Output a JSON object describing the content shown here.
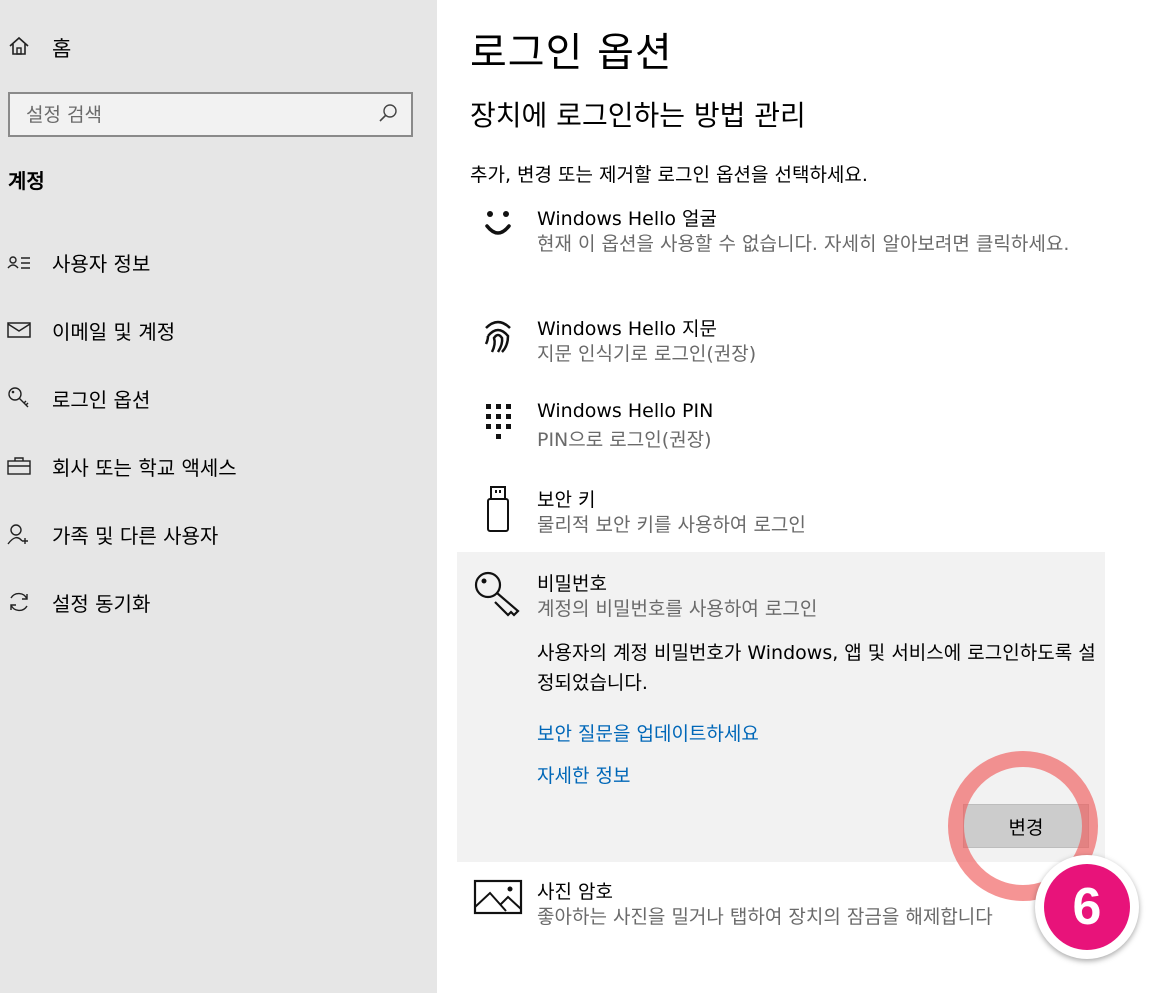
{
  "sidebar": {
    "home_label": "홈",
    "search_placeholder": "설정 검색",
    "section_title": "계정",
    "items": [
      {
        "label": "사용자 정보",
        "icon": "user-info-icon"
      },
      {
        "label": "이메일 및 계정",
        "icon": "mail-icon"
      },
      {
        "label": "로그인 옵션",
        "icon": "key-icon"
      },
      {
        "label": "회사 또는 학교 액세스",
        "icon": "briefcase-icon"
      },
      {
        "label": "가족 및 다른 사용자",
        "icon": "add-user-icon"
      },
      {
        "label": "설정 동기화",
        "icon": "sync-icon"
      }
    ]
  },
  "main": {
    "title": "로그인 옵션",
    "subtitle": "장치에 로그인하는 방법 관리",
    "description": "추가, 변경 또는 제거할 로그인 옵션을 선택하세요.",
    "options": [
      {
        "title": "Windows Hello 얼굴",
        "subtitle": "현재 이 옵션을 사용할 수 없습니다. 자세히 알아보려면 클릭하세요.",
        "icon": "face-icon"
      },
      {
        "title": "Windows Hello 지문",
        "subtitle": "지문 인식기로 로그인(권장)",
        "icon": "fingerprint-icon"
      },
      {
        "title": "Windows Hello PIN",
        "subtitle": "PIN으로 로그인(권장)",
        "icon": "pin-keypad-icon"
      },
      {
        "title": "보안 키",
        "subtitle": "물리적 보안 키를 사용하여 로그인",
        "icon": "usb-key-icon"
      },
      {
        "title": "비밀번호",
        "subtitle": "계정의 비밀번호를 사용하여 로그인",
        "icon": "password-key-icon"
      },
      {
        "title": "사진 암호",
        "subtitle": "좋아하는 사진을 밀거나 탭하여 장치의 잠금을 해제합니다",
        "icon": "picture-icon"
      }
    ],
    "password_panel": {
      "info": "사용자의 계정 비밀번호가 Windows, 앱 및 서비스에 로그인하도록 설정되었습니다.",
      "link_security_questions": "보안 질문을 업데이트하세요",
      "link_more_info": "자세한 정보",
      "change_button": "변경"
    }
  },
  "annotation": {
    "step_number": "6",
    "ring_color": "#f05a5a",
    "badge_color": "#e8137a"
  }
}
